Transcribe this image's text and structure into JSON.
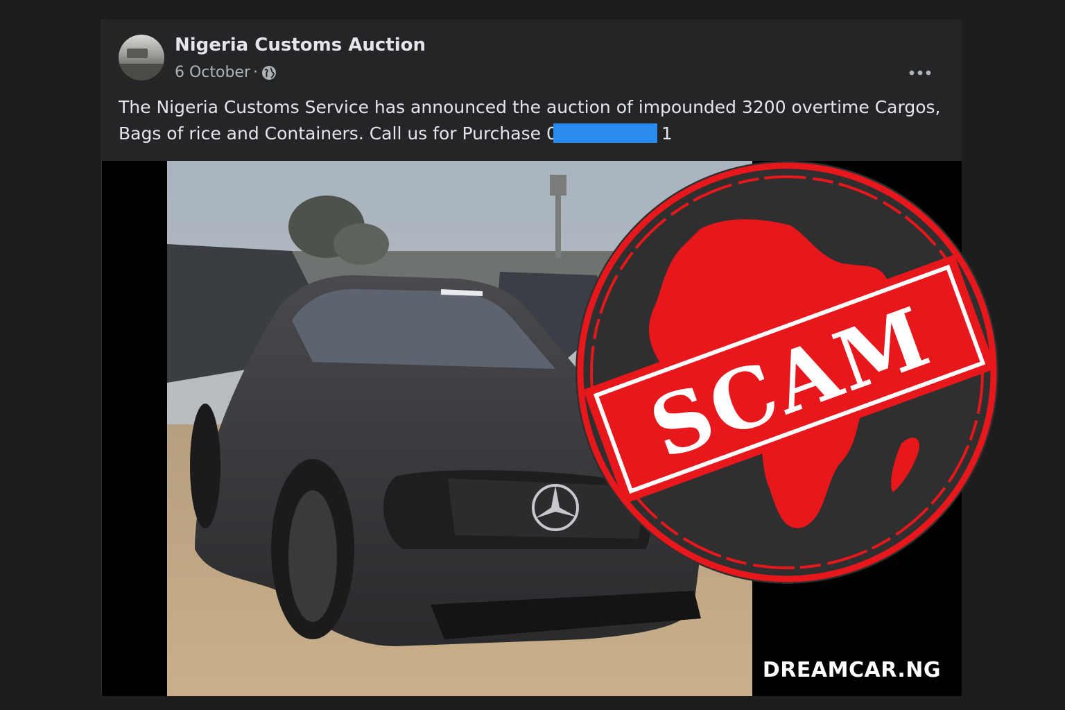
{
  "post": {
    "page_name": "Nigeria Customs Auction",
    "date": "6 October",
    "separator": "·",
    "text_line1": "The Nigeria Customs Service has announced the auction of impounded 3200 overtime Cargos,",
    "text_line2_prefix": "Bags of rice and Containers. Call us for Purchase ",
    "phone_visible_start": "0",
    "phone_visible_end": "1",
    "icons": {
      "privacy": "globe-icon",
      "menu": "more-options-icon"
    }
  },
  "image": {
    "watermark": "DREAMCAR.NG",
    "stamp_text": "SCAM",
    "stamp_color": "#e8171c",
    "description_colors": {
      "stamp_bg": "#2e2e2e",
      "redaction": "#2a8bef"
    }
  }
}
